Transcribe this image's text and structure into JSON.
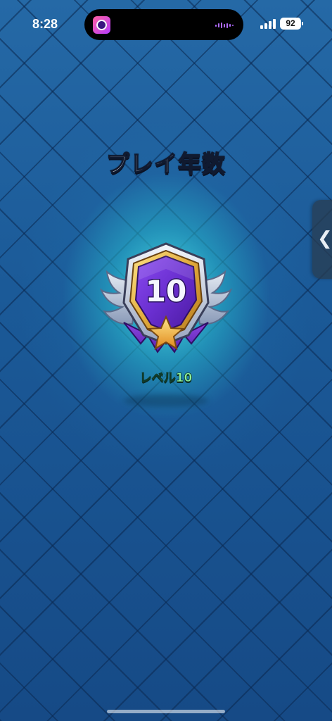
{
  "status_bar": {
    "time": "8:28",
    "battery": "92",
    "app_icon": "app-clover-icon"
  },
  "screen": {
    "title": "プレイ年数",
    "badge": {
      "number": "10",
      "label": "レベル10",
      "icon": "star-icon"
    },
    "side_tab_icon": "❮"
  },
  "colors": {
    "background": "#1d5a95",
    "glow": "#50f0f0",
    "badge_purple": "#6a2fd0",
    "badge_gold": "#f0c040",
    "label_green": "#8ef09a"
  }
}
